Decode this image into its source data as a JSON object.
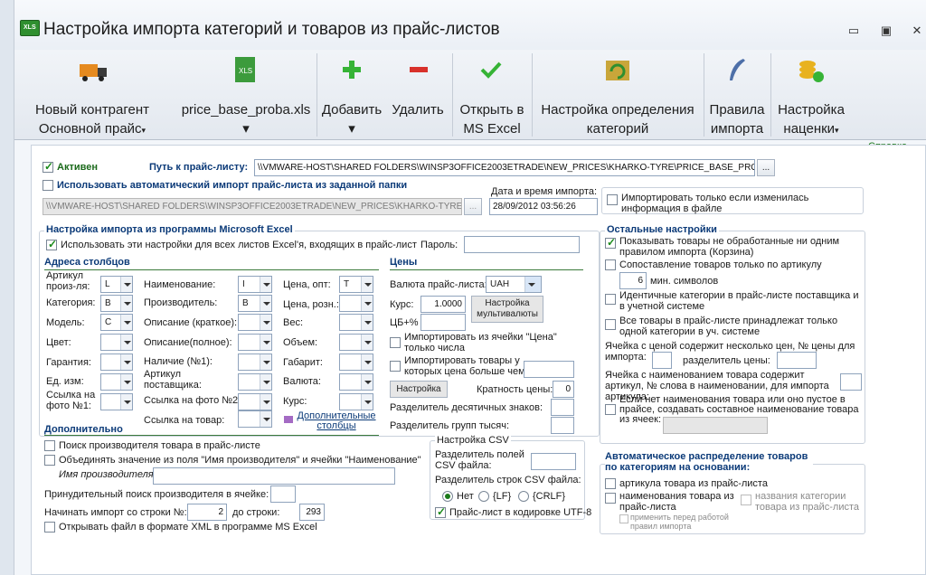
{
  "window": {
    "title": "Настройка импорта категорий и товаров из прайс-листов"
  },
  "ribbon": {
    "counterparty_line1": "Новый контрагент",
    "counterparty_line2": "Основной прайс",
    "file_label": "price_base_proba.xls",
    "add_label": "Добавить",
    "delete_label": "Удалить",
    "open_line1": "Открыть в",
    "open_line2": "MS Excel",
    "catdef_line1": "Настройка определения",
    "catdef_line2": "категорий",
    "rules_line1": "Правила",
    "rules_line2": "импорта",
    "markup_line1": "Настройка",
    "markup_line2": "наценки"
  },
  "help_link": "Справка",
  "top": {
    "active_label": "Активен",
    "path_label": "Путь к прайс-листу:",
    "path_value": "\\\\VMWARE-HOST\\SHARED FOLDERS\\WINSP3OFFICE2003ETRADE\\NEW_PRICES\\KHARKO-TYRE\\PRICE_BASE_PROBA.",
    "browse": "...",
    "auto_import_label": "Использовать автоматический импорт прайс-листа из заданной папки",
    "auto_path_value": "\\\\VMWARE-HOST\\SHARED FOLDERS\\WINSP3OFFICE2003ETRADE\\NEW_PRICES\\KHARKO-TYRE\\",
    "datetime_label": "Дата и время импорта:",
    "datetime_value": "28/09/2012 03:56:26",
    "only_changed_label": "Импортировать только если изменилась информация в файле"
  },
  "excel": {
    "title": "Настройка импорта из программы Microsoft Excel",
    "use_all_label": "Использовать эти настройки для всех листов Excel'я, входящих в прайс-лист",
    "password_label": "Пароль:",
    "columns_title": "Адреса столбцов",
    "prices_title": "Цены",
    "col1": [
      {
        "label": "Артикул произ-ля:",
        "value": "L"
      },
      {
        "label": "Категория:",
        "value": "B"
      },
      {
        "label": "Модель:",
        "value": "C"
      },
      {
        "label": "Цвет:",
        "value": ""
      },
      {
        "label": "Гарантия:",
        "value": ""
      },
      {
        "label": "Ед. изм:",
        "value": ""
      },
      {
        "label": "Ссылка на фото №1:",
        "value": ""
      }
    ],
    "col2": [
      {
        "label": "Наименование:",
        "value": "I"
      },
      {
        "label": "Производитель:",
        "value": "B"
      },
      {
        "label": "Описание (краткое):",
        "value": ""
      },
      {
        "label": "Описание(полное):",
        "value": ""
      },
      {
        "label": "Наличие (№1):",
        "value": ""
      },
      {
        "label": "Артикул поставщика:",
        "value": ""
      },
      {
        "label": "Ссылка на фото №2:",
        "value": ""
      },
      {
        "label": "Ссылка на товар:",
        "value": ""
      }
    ],
    "col3": [
      {
        "label": "Цена, опт:",
        "value": "T"
      },
      {
        "label": "Цена, розн.:",
        "value": ""
      },
      {
        "label": "Вес:",
        "value": ""
      },
      {
        "label": "Объем:",
        "value": ""
      },
      {
        "label": "Габарит:",
        "value": ""
      },
      {
        "label": "Валюта:",
        "value": ""
      },
      {
        "label": "Курс:",
        "value": ""
      }
    ],
    "extra_columns": "Дополнительные столбцы",
    "currency_label": "Валюта прайс-листа:",
    "currency_value": "UAH",
    "rate_label": "Курс:",
    "rate_value": "1.0000",
    "cb_label": "ЦБ+%",
    "multicurrency_button": "Настройка мультивалюты",
    "import_numbers_label": "Импортировать из ячейки \"Цена\" только числа",
    "import_price_gt_label": "Импортировать товары у которых цена больше чем:",
    "settings_button": "Настройка",
    "multiplicity_label": "Кратность цены:",
    "multiplicity_value": "0",
    "decimal_sep_label": "Разделитель десятичных знаков:",
    "group_sep_label": "Разделитель групп тысяч:"
  },
  "additional": {
    "title": "Дополнительно",
    "search_manufacturer": "Поиск производителя товара в прайс-листе",
    "merge_label": "Объединять значение из поля \"Имя производителя\" и ячейки \"Наименование\"",
    "manufacturer_name_label": "Имя производителя:",
    "forced_search_label": "Принудительный поиск производителя в ячейке:",
    "start_row_label": "Начинать импорт со строки №:",
    "start_row_value": "2",
    "to_row_label": "до строки:",
    "to_row_value": "293",
    "open_xml_label": "Открывать файл в формате XML в программе MS Excel"
  },
  "csv": {
    "title": "Настройка CSV",
    "field_sep_label": "Разделитель полей CSV файла:",
    "line_sep_label": "Разделитель строк CSV файла:",
    "radio_none": "Нет",
    "radio_lf": "{LF}",
    "radio_crlf": "{CRLF}",
    "utf8_label": "Прайс-лист в кодировке UTF-8"
  },
  "other": {
    "title": "Остальные настройки",
    "show_unprocessed": "Показывать товары не обработанные ни одним правилом импорта (Корзина)",
    "match_by_article": "Сопоставление товаров только по артикулу",
    "min_symbols_value": "6",
    "min_symbols_label": "мин. символов",
    "identical_categories": "Идентичные категории в прайс-листе поставщика и в учетной системе",
    "all_in_one_category": "Все товары в прайс-листе принадлежат только одной категории в уч. системе",
    "multi_price_label": "Ячейка с ценой содержит несколько цен, № цены для импорта:",
    "price_sep_label": "разделитель цены:",
    "name_contains_article_label": "Ячейка с наименованием товара содержит артикул, № слова в наименовании, для импорта артикула:",
    "composite_name_label": "Если нет наименования товара или оно пустое в прайсе, создавать составное наименование товара из ячеек:"
  },
  "autodist": {
    "title": "Автоматическое распределение товаров по категориям на основании:",
    "by_article": "артикула товара из прайс-листа",
    "by_name": "наименования товара из прайс-листа",
    "by_category_names": "названия категории товара из прайс-листа",
    "apply_before_rules": "применить перед работой правил импорта"
  }
}
